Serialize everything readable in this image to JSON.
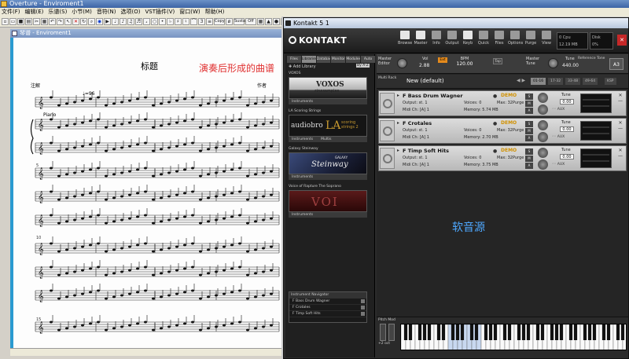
{
  "overture": {
    "window_title": "Overture - Enviroment1",
    "menu": [
      "文件(F)",
      "编辑(E)",
      "乐谱(S)",
      "小节(M)",
      "音符(N)",
      "选项(O)",
      "VST插件(V)",
      "窗口(W)",
      "帮助(H)"
    ],
    "toolbar_labels": [
      "Copy",
      "Sustain",
      "Off"
    ],
    "document_title": "琴谱 - Enviroment1",
    "score": {
      "title": "标题",
      "left_label": "注解",
      "right_label": "作者",
      "tempo": "♩=96",
      "instrument": "Piano",
      "measure_numbers": [
        "5",
        "10",
        "15"
      ],
      "annotation": "演奏后形成的曲谱"
    }
  },
  "kontakt": {
    "window_title": "Kontakt 5 1",
    "logo": "KONTAKT",
    "header_buttons": [
      "Browse",
      "Master",
      "Info",
      "Output",
      "Keyb",
      "Quick",
      "Files",
      "Options",
      "Purge",
      "View"
    ],
    "cpu": {
      "label": "Cpu",
      "value": "0%",
      "voices": "0",
      "mem": "12.19 MB"
    },
    "disk": {
      "label": "Disk",
      "value": "0%"
    },
    "browser": {
      "tabs": [
        "Files",
        "Libraries",
        "Database",
        "Monitor",
        "Modules",
        "Auto"
      ],
      "add_library": "Add Library",
      "sort": "By A-Z",
      "libraries": [
        {
          "name": "VOXOS",
          "title": "VOXOS",
          "subtitle": "cinesamples",
          "footer": [
            "Instruments"
          ]
        },
        {
          "name": "LA Scoring Strings",
          "brand": "audiobro",
          "title": "LA",
          "subtitle": "scoring strings 2",
          "footer": [
            "Instruments",
            "Multis"
          ]
        },
        {
          "name": "Galaxy Steinway",
          "title": "Steinway",
          "subtitle": "GALAXY",
          "footer": [
            "Instruments"
          ]
        },
        {
          "name": "Voice of Rapture The Soprano",
          "title": "VOI",
          "footer": [
            "Instruments"
          ]
        }
      ],
      "navigator": {
        "title": "Instrument Navigator",
        "items": [
          "F Bass Drum Wagner",
          "F Crotales",
          "F Timp Soft Hits"
        ]
      }
    },
    "master": {
      "editor_label": "Master Editor",
      "vol_label": "Vol",
      "vol_value": "2.88",
      "ext_label": "Ext",
      "bpm_label": "BPM",
      "bpm_value": "120.00",
      "tap_label": "Tap",
      "tune_section_label": "Master Tune",
      "tune_label": "Tune",
      "tune_value": "440.00",
      "ref_label": "Reference Tone",
      "ref_note": "A3"
    },
    "multi": {
      "label": "Multi Rack",
      "name": "New (default)",
      "tabs": [
        "01-16",
        "17-32",
        "33-48",
        "49-64",
        "KSP"
      ]
    },
    "instruments": [
      {
        "name": "F Bass Drum Wagner",
        "demo": "DEMO",
        "output": "st. 1",
        "midi": "[A] 1",
        "voices": "0",
        "max": "32",
        "memory": "5.74 MB"
      },
      {
        "name": "F Crotales",
        "demo": "DEMO",
        "output": "st. 1",
        "midi": "[A] 1",
        "voices": "0",
        "max": "32",
        "memory": "2.70 MB"
      },
      {
        "name": "F Timp Soft Hits",
        "demo": "DEMO",
        "output": "st. 1",
        "midi": "[A] 1",
        "voices": "0",
        "max": "32",
        "memory": "3.75 MB"
      }
    ],
    "inst_labels": {
      "output": "Output:",
      "midi": "Midi Ch:",
      "voices": "Voices:",
      "max": "Max:",
      "memory": "Memory:",
      "purge": "Purge",
      "tune": "Tune",
      "tune_value": "0.00"
    },
    "soft_source_annotation": "软音源",
    "pitch_mod": "Pitch Mod",
    "octave": "+2 oct"
  },
  "colors": {
    "annotation_red": "#e03030",
    "annotation_blue": "#4ea8ff",
    "demo_orange": "#d09000"
  }
}
